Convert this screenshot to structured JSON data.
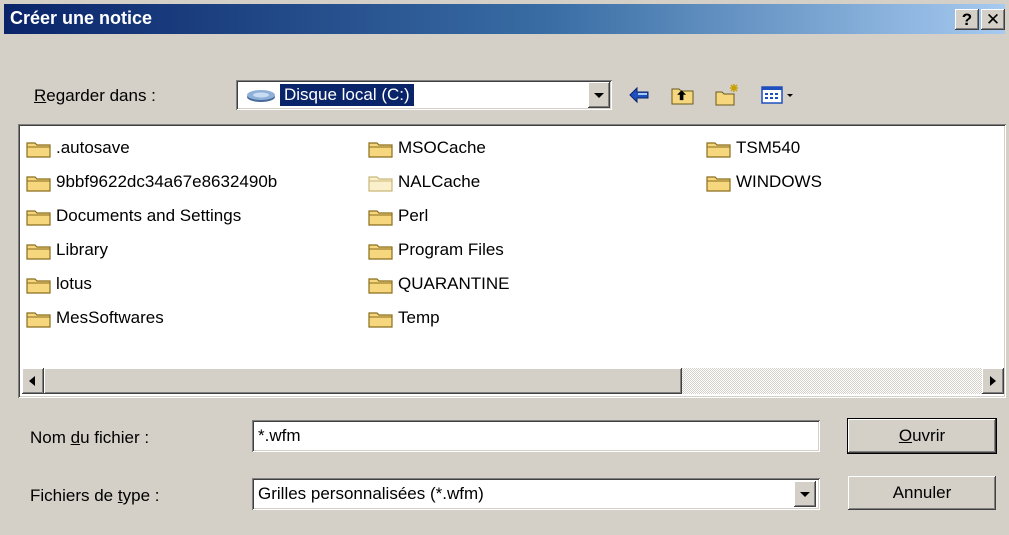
{
  "window": {
    "title": "Créer une notice",
    "help_button": "?",
    "close_button": "✕"
  },
  "lookin": {
    "label_prefix": "",
    "label_accel": "R",
    "label_rest": "egarder dans :",
    "value": "Disque local (C:)"
  },
  "toolbar": {
    "back_icon": "back-arrow-icon",
    "up_icon": "up-folder-icon",
    "new_folder_icon": "new-folder-icon",
    "view_menu_icon": "view-menu-icon"
  },
  "files": {
    "column1": [
      ".autosave",
      "9bbf9622dc34a67e8632490b",
      "Documents and Settings",
      "Library",
      "lotus",
      "MesSoftwares"
    ],
    "column2": [
      "MSOCache",
      "NALCache",
      "Perl",
      "Program Files",
      "QUARANTINE",
      "Temp"
    ],
    "column3": [
      "TSM540",
      "WINDOWS"
    ]
  },
  "filename": {
    "label_prefix": "Nom ",
    "label_accel": "d",
    "label_rest": "u fichier :",
    "value": "*.wfm"
  },
  "filetype": {
    "label_prefix": "Fichiers de ",
    "label_accel": "t",
    "label_rest": "ype :",
    "value": "Grilles personnalisées (*.wfm)"
  },
  "buttons": {
    "open_accel": "O",
    "open_rest": "uvrir",
    "cancel": "Annuler"
  },
  "colors": {
    "title_bar": "#0a246a",
    "folder": "#f6d77d",
    "dialog_bg": "#d4d0c8"
  }
}
